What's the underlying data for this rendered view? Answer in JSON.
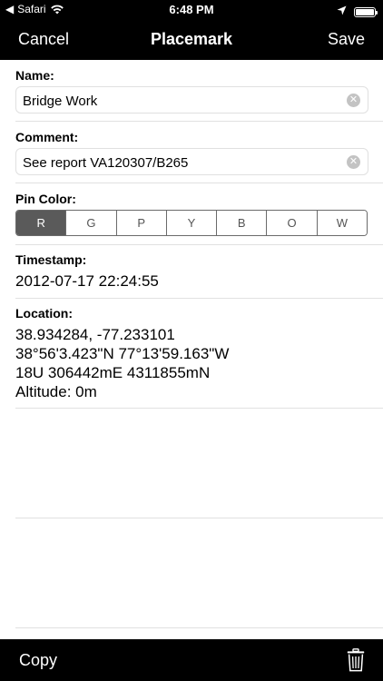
{
  "status_bar": {
    "back_app": "Safari",
    "time": "6:48 PM"
  },
  "nav": {
    "cancel": "Cancel",
    "title": "Placemark",
    "save": "Save"
  },
  "form": {
    "name": {
      "label": "Name:",
      "value": "Bridge Work"
    },
    "comment": {
      "label": "Comment:",
      "value": "See report VA120307/B265"
    },
    "pin_color": {
      "label": "Pin Color:",
      "options": [
        "R",
        "G",
        "P",
        "Y",
        "B",
        "O",
        "W"
      ],
      "selected": "R"
    },
    "timestamp": {
      "label": "Timestamp:",
      "value": "2012-07-17 22:24:55"
    },
    "location": {
      "label": "Location:",
      "lines": [
        "38.934284, -77.233101",
        "38°56'3.423\"N 77°13'59.163\"W",
        "18U 306442mE 4311855mN",
        "Altitude: 0m"
      ]
    }
  },
  "toolbar": {
    "copy": "Copy"
  },
  "icons": {
    "back": "back-arrow-icon",
    "wifi": "wifi-icon",
    "location": "location-arrow-icon",
    "battery": "battery-icon",
    "clear": "clear-icon",
    "trash": "trash-icon"
  },
  "colors": {
    "bars": "#000000",
    "selected_segment": "#5a5a5a"
  }
}
